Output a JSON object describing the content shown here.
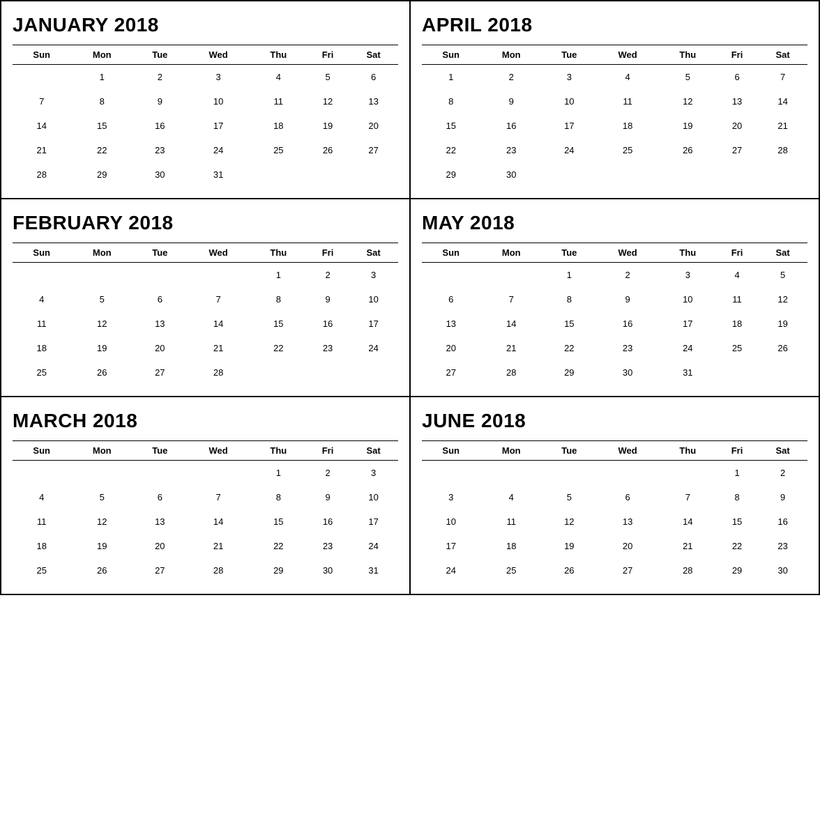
{
  "months": [
    {
      "name": "JANUARY 2018",
      "days": [
        "Sun",
        "Mon",
        "Tue",
        "Wed",
        "Thu",
        "Fri",
        "Sat"
      ],
      "weeks": [
        [
          "",
          "1",
          "2",
          "3",
          "4",
          "5",
          "6"
        ],
        [
          "7",
          "8",
          "9",
          "10",
          "11",
          "12",
          "13"
        ],
        [
          "14",
          "15",
          "16",
          "17",
          "18",
          "19",
          "20"
        ],
        [
          "21",
          "22",
          "23",
          "24",
          "25",
          "26",
          "27"
        ],
        [
          "28",
          "29",
          "30",
          "31",
          "",
          "",
          ""
        ]
      ]
    },
    {
      "name": "APRIL 2018",
      "days": [
        "Sun",
        "Mon",
        "Tue",
        "Wed",
        "Thu",
        "Fri",
        "Sat"
      ],
      "weeks": [
        [
          "1",
          "2",
          "3",
          "4",
          "5",
          "6",
          "7"
        ],
        [
          "8",
          "9",
          "10",
          "11",
          "12",
          "13",
          "14"
        ],
        [
          "15",
          "16",
          "17",
          "18",
          "19",
          "20",
          "21"
        ],
        [
          "22",
          "23",
          "24",
          "25",
          "26",
          "27",
          "28"
        ],
        [
          "29",
          "30",
          "",
          "",
          "",
          "",
          ""
        ]
      ]
    },
    {
      "name": "FEBRUARY 2018",
      "days": [
        "Sun",
        "Mon",
        "Tue",
        "Wed",
        "Thu",
        "Fri",
        "Sat"
      ],
      "weeks": [
        [
          "",
          "",
          "",
          "",
          "1",
          "2",
          "3"
        ],
        [
          "4",
          "5",
          "6",
          "7",
          "8",
          "9",
          "10"
        ],
        [
          "11",
          "12",
          "13",
          "14",
          "15",
          "16",
          "17"
        ],
        [
          "18",
          "19",
          "20",
          "21",
          "22",
          "23",
          "24"
        ],
        [
          "25",
          "26",
          "27",
          "28",
          "",
          "",
          ""
        ]
      ]
    },
    {
      "name": "MAY 2018",
      "days": [
        "Sun",
        "Mon",
        "Tue",
        "Wed",
        "Thu",
        "Fri",
        "Sat"
      ],
      "weeks": [
        [
          "",
          "",
          "1",
          "2",
          "3",
          "4",
          "5"
        ],
        [
          "6",
          "7",
          "8",
          "9",
          "10",
          "11",
          "12"
        ],
        [
          "13",
          "14",
          "15",
          "16",
          "17",
          "18",
          "19"
        ],
        [
          "20",
          "21",
          "22",
          "23",
          "24",
          "25",
          "26"
        ],
        [
          "27",
          "28",
          "29",
          "30",
          "31",
          "",
          ""
        ]
      ]
    },
    {
      "name": "MARCH 2018",
      "days": [
        "Sun",
        "Mon",
        "Tue",
        "Wed",
        "Thu",
        "Fri",
        "Sat"
      ],
      "weeks": [
        [
          "",
          "",
          "",
          "",
          "1",
          "2",
          "3"
        ],
        [
          "4",
          "5",
          "6",
          "7",
          "8",
          "9",
          "10"
        ],
        [
          "11",
          "12",
          "13",
          "14",
          "15",
          "16",
          "17"
        ],
        [
          "18",
          "19",
          "20",
          "21",
          "22",
          "23",
          "24"
        ],
        [
          "25",
          "26",
          "27",
          "28",
          "29",
          "30",
          "31"
        ]
      ]
    },
    {
      "name": "JUNE 2018",
      "days": [
        "Sun",
        "Mon",
        "Tue",
        "Wed",
        "Thu",
        "Fri",
        "Sat"
      ],
      "weeks": [
        [
          "",
          "",
          "",
          "",
          "",
          "1",
          "2"
        ],
        [
          "3",
          "4",
          "5",
          "6",
          "7",
          "8",
          "9"
        ],
        [
          "10",
          "11",
          "12",
          "13",
          "14",
          "15",
          "16"
        ],
        [
          "17",
          "18",
          "19",
          "20",
          "21",
          "22",
          "23"
        ],
        [
          "24",
          "25",
          "26",
          "27",
          "28",
          "29",
          "30"
        ]
      ]
    }
  ]
}
